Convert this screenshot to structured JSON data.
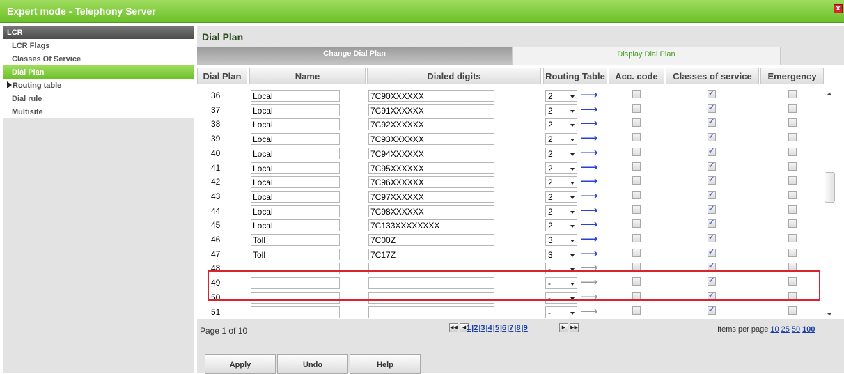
{
  "window": {
    "title": "Expert mode - Telephony Server",
    "close_label": "x"
  },
  "sidebar": {
    "header": "LCR",
    "items": [
      {
        "label": "LCR Flags"
      },
      {
        "label": "Classes Of Service"
      },
      {
        "label": "Dial Plan"
      },
      {
        "label": "Routing table"
      },
      {
        "label": "Dial rule"
      },
      {
        "label": "Multisite"
      }
    ]
  },
  "main": {
    "title": "Dial Plan",
    "tabs": [
      {
        "label": "Change Dial Plan"
      },
      {
        "label": "Display Dial Plan"
      }
    ],
    "columns": [
      "Dial Plan",
      "Name",
      "Dialed digits",
      "Routing Table",
      "Acc. code",
      "Classes of service",
      "Emergency"
    ],
    "rows": [
      {
        "num": "36",
        "name": "Local",
        "digits": "7C90XXXXXX",
        "route": "2",
        "acc": false,
        "cos": true,
        "emergency": false
      },
      {
        "num": "37",
        "name": "Local",
        "digits": "7C91XXXXXX",
        "route": "2",
        "acc": false,
        "cos": true,
        "emergency": false
      },
      {
        "num": "38",
        "name": "Local",
        "digits": "7C92XXXXXX",
        "route": "2",
        "acc": false,
        "cos": true,
        "emergency": false
      },
      {
        "num": "39",
        "name": "Local",
        "digits": "7C93XXXXXX",
        "route": "2",
        "acc": false,
        "cos": true,
        "emergency": false
      },
      {
        "num": "40",
        "name": "Local",
        "digits": "7C94XXXXXX",
        "route": "2",
        "acc": false,
        "cos": true,
        "emergency": false
      },
      {
        "num": "41",
        "name": "Local",
        "digits": "7C95XXXXXX",
        "route": "2",
        "acc": false,
        "cos": true,
        "emergency": false
      },
      {
        "num": "42",
        "name": "Local",
        "digits": "7C96XXXXXX",
        "route": "2",
        "acc": false,
        "cos": true,
        "emergency": false
      },
      {
        "num": "43",
        "name": "Local",
        "digits": "7C97XXXXXX",
        "route": "2",
        "acc": false,
        "cos": true,
        "emergency": false
      },
      {
        "num": "44",
        "name": "Local",
        "digits": "7C98XXXXXX",
        "route": "2",
        "acc": false,
        "cos": true,
        "emergency": false
      },
      {
        "num": "45",
        "name": "Local",
        "digits": "7C133XXXXXXXX",
        "route": "2",
        "acc": false,
        "cos": true,
        "emergency": false
      },
      {
        "num": "46",
        "name": "Toll",
        "digits": "7C00Z",
        "route": "3",
        "acc": false,
        "cos": true,
        "emergency": false
      },
      {
        "num": "47",
        "name": "Toll",
        "digits": "7C17Z",
        "route": "3",
        "acc": false,
        "cos": true,
        "emergency": false
      },
      {
        "num": "48",
        "name": "",
        "digits": "",
        "route": "-",
        "acc": false,
        "cos": true,
        "emergency": false
      },
      {
        "num": "49",
        "name": "",
        "digits": "",
        "route": "-",
        "acc": false,
        "cos": true,
        "emergency": false
      },
      {
        "num": "50",
        "name": "",
        "digits": "",
        "route": "-",
        "acc": false,
        "cos": true,
        "emergency": false
      },
      {
        "num": "51",
        "name": "",
        "digits": "",
        "route": "-",
        "acc": false,
        "cos": true,
        "emergency": false
      }
    ]
  },
  "pager": {
    "page_info": "Page 1 of 10",
    "pages": [
      "1",
      "2",
      "3",
      "4",
      "5",
      "6",
      "7",
      "8",
      "9"
    ],
    "items_per_page_label": "Items per page",
    "items_per_page_options": [
      "10",
      "25",
      "50",
      "100"
    ],
    "selected_items_per_page": "100"
  },
  "buttons": {
    "apply": "Apply",
    "undo": "Undo",
    "help": "Help"
  },
  "colors": {
    "accent_green": "#6cc12a",
    "highlight_red": "#d9232e",
    "link_blue": "#1a3ea6"
  }
}
